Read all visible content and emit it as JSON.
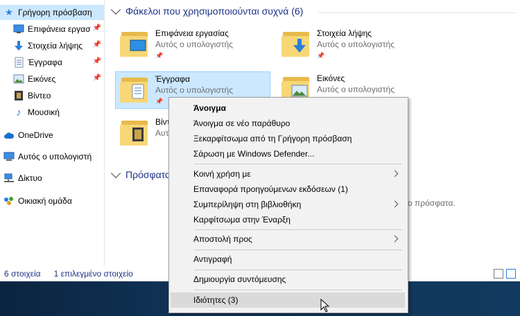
{
  "sidebar": {
    "items": [
      {
        "label": "Γρήγορη πρόσβαση",
        "icon": "star-icon",
        "pinned": false,
        "selected": true
      },
      {
        "label": "Επιφάνεια εργασ",
        "icon": "desktop-icon",
        "pinned": true
      },
      {
        "label": "Στοιχεία λήψης",
        "icon": "download-icon",
        "pinned": true
      },
      {
        "label": "Έγγραφα",
        "icon": "document-icon",
        "pinned": true
      },
      {
        "label": "Εικόνες",
        "icon": "pictures-icon",
        "pinned": true
      },
      {
        "label": "Βίντεο",
        "icon": "video-icon",
        "pinned": false
      },
      {
        "label": "Μουσική",
        "icon": "music-icon",
        "pinned": false
      },
      {
        "label": "OneDrive",
        "icon": "cloud-icon"
      },
      {
        "label": "Αυτός ο υπολογιστή",
        "icon": "computer-icon"
      },
      {
        "label": "Δίκτυο",
        "icon": "network-icon"
      },
      {
        "label": "Οικιακή ομάδα",
        "icon": "homegroup-icon"
      }
    ]
  },
  "main": {
    "frequent_header": "Φάκελοι που χρησιμοποιούνται συχνά (6)",
    "recent_header_partial": "Πρόσφατα",
    "folders": [
      {
        "name": "Επιφάνεια εργασίας",
        "location": "Αυτός ο υπολογιστής"
      },
      {
        "name": "Στοιχεία λήψης",
        "location": "Αυτός ο υπολογιστής"
      },
      {
        "name": "Έγγραφα",
        "location": "Αυτός ο υπολογιστής"
      },
      {
        "name": "Εικόνες",
        "location": "Αυτός ο υπολογιστής"
      },
      {
        "name": "Βίντ",
        "location": "Αυτ"
      }
    ],
    "recent_empty_partial": "ο πρόσφατα."
  },
  "status": {
    "count": "6 στοιχεία",
    "selected": "1 επιλεγμένο στοιχείο"
  },
  "context_menu": {
    "items": [
      {
        "label": "Άνοιγμα",
        "bold": true
      },
      {
        "label": "Άνοιγμα σε νέο παράθυρο"
      },
      {
        "label": "Ξεκαρφίτσωμα από τη Γρήγορη πρόσβαση"
      },
      {
        "label": "Σάρωση με Windows Defender..."
      },
      {
        "label": "Κοινή χρήση με",
        "submenu": true
      },
      {
        "label": "Επαναφορά προηγούμενων εκδόσεων (1)"
      },
      {
        "label": "Συμπερίληψη στη βιβλιοθήκη",
        "submenu": true
      },
      {
        "label": "Καρφίτσωμα στην Έναρξη"
      },
      {
        "label": "Αποστολή προς",
        "submenu": true
      },
      {
        "label": "Αντιγραφή"
      },
      {
        "label": "Δημιουργία συντόμευσης"
      },
      {
        "label": "Ιδιότητες (3)",
        "hover": true
      }
    ]
  },
  "colors": {
    "selection": "#cce8ff",
    "header_text": "#1e3287",
    "menu_bg": "#f2f2f2",
    "taskbar": "#0f3055"
  }
}
